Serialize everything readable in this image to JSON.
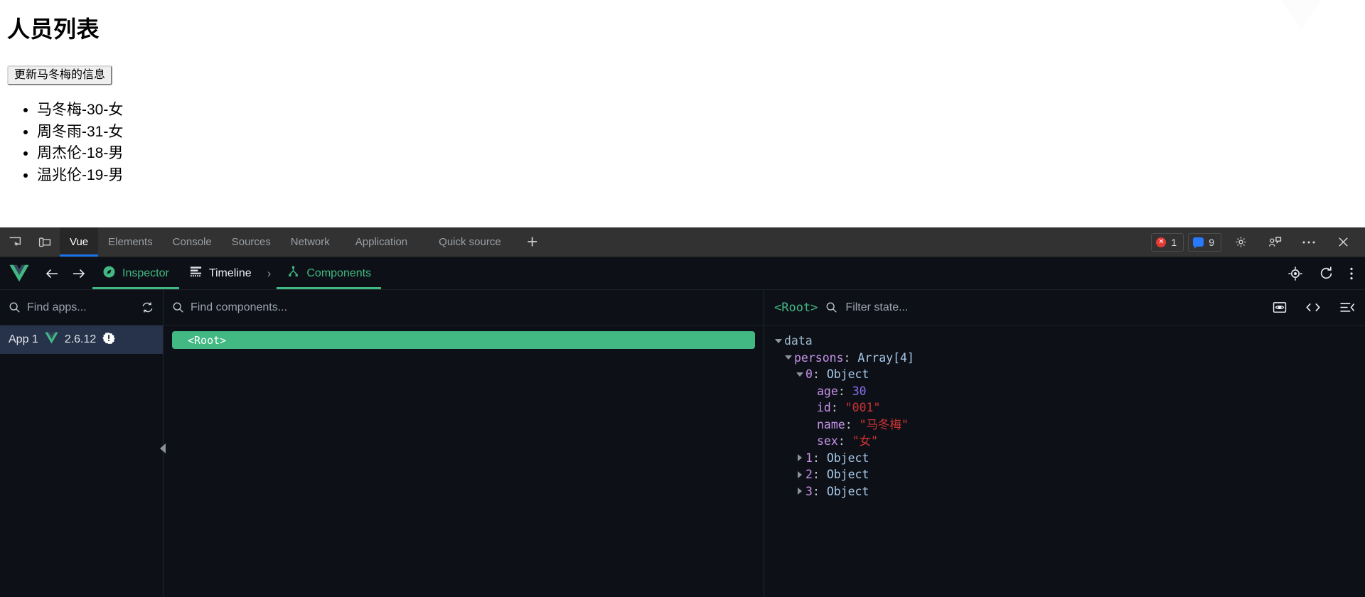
{
  "page": {
    "title": "人员列表",
    "button_label": "更新马冬梅的信息",
    "list": [
      "马冬梅-30-女",
      "周冬雨-31-女",
      "周杰伦-18-男",
      "温兆伦-19-男"
    ]
  },
  "devtools": {
    "left_icons": [
      {
        "name": "inspect-element-icon"
      },
      {
        "name": "device-toolbar-icon"
      }
    ],
    "tabs": [
      {
        "label": "Vue",
        "active": true
      },
      {
        "label": "Elements",
        "active": false
      },
      {
        "label": "Console",
        "active": false
      },
      {
        "label": "Sources",
        "active": false
      },
      {
        "label": "Network",
        "active": false
      },
      {
        "label": "Application",
        "active": false
      },
      {
        "label": "Quick source",
        "active": false
      }
    ],
    "add_tab_label": "+",
    "error_badge": {
      "count": "1",
      "color": "#e53935"
    },
    "message_badge": {
      "count": "9",
      "color": "#2979ff"
    },
    "right_icons": [
      {
        "name": "settings-gear-icon"
      },
      {
        "name": "feedback-icon"
      },
      {
        "name": "more-options-icon"
      },
      {
        "name": "close-icon"
      }
    ]
  },
  "vue_toolbar": {
    "logo_name": "vue-logo",
    "back_label": "←",
    "forward_label": "→",
    "items": [
      {
        "label": "Inspector",
        "active": true,
        "style": "green"
      },
      {
        "label": "Timeline",
        "active": false,
        "style": "white"
      }
    ],
    "separator": "›",
    "components_label": "Components",
    "right_icons": [
      {
        "name": "select-component-icon"
      },
      {
        "name": "refresh-icon"
      },
      {
        "name": "vertical-dots-menu-icon"
      }
    ]
  },
  "apps_pane": {
    "search_placeholder": "Find apps...",
    "refresh_icon": "refresh-apps-icon",
    "apps": [
      {
        "name": "App 1",
        "version": "2.6.12",
        "badge": "warning-badge-icon",
        "selected": true
      }
    ]
  },
  "components_pane": {
    "search_placeholder": "Find components...",
    "nodes": [
      {
        "label": "<Root>",
        "selected": true
      }
    ],
    "collapse_handle": "collapse-sidebar-arrow"
  },
  "state_pane": {
    "component_name": "<Root>",
    "filter_placeholder": "Filter state...",
    "header_icons": [
      {
        "name": "inspect-dom-icon"
      },
      {
        "name": "open-in-editor-icon"
      },
      {
        "name": "collapse-all-icon"
      }
    ],
    "tree": [
      {
        "indent": 0,
        "twisty": "down",
        "key": "data",
        "key_style": "root",
        "sep": "",
        "value": "",
        "value_style": ""
      },
      {
        "indent": 1,
        "twisty": "down",
        "key": "persons",
        "key_style": "key",
        "sep": ": ",
        "value": "Array[4]",
        "value_style": "type"
      },
      {
        "indent": 2,
        "twisty": "down",
        "key": "0",
        "key_style": "key",
        "sep": ": ",
        "value": "Object",
        "value_style": "type"
      },
      {
        "indent": 3,
        "twisty": "blank",
        "key": "age",
        "key_style": "key",
        "sep": ": ",
        "value": "30",
        "value_style": "num"
      },
      {
        "indent": 3,
        "twisty": "blank",
        "key": "id",
        "key_style": "key",
        "sep": ": ",
        "value": "\"001\"",
        "value_style": "str"
      },
      {
        "indent": 3,
        "twisty": "blank",
        "key": "name",
        "key_style": "key",
        "sep": ": ",
        "value": "\"马冬梅\"",
        "value_style": "str"
      },
      {
        "indent": 3,
        "twisty": "blank",
        "key": "sex",
        "key_style": "key",
        "sep": ": ",
        "value": "\"女\"",
        "value_style": "str"
      },
      {
        "indent": 2,
        "twisty": "right",
        "key": "1",
        "key_style": "key",
        "sep": ": ",
        "value": "Object",
        "value_style": "type"
      },
      {
        "indent": 2,
        "twisty": "right",
        "key": "2",
        "key_style": "key",
        "sep": ": ",
        "value": "Object",
        "value_style": "type"
      },
      {
        "indent": 2,
        "twisty": "right",
        "key": "3",
        "key_style": "key",
        "sep": ": ",
        "value": "Object",
        "value_style": "type"
      }
    ]
  },
  "colors": {
    "vue_green": "#42b883",
    "devtools_blue": "#1a73e8",
    "panel_bg": "#0d1117",
    "tabstrip_bg": "#323232",
    "selected_app_bg": "#26334a"
  }
}
